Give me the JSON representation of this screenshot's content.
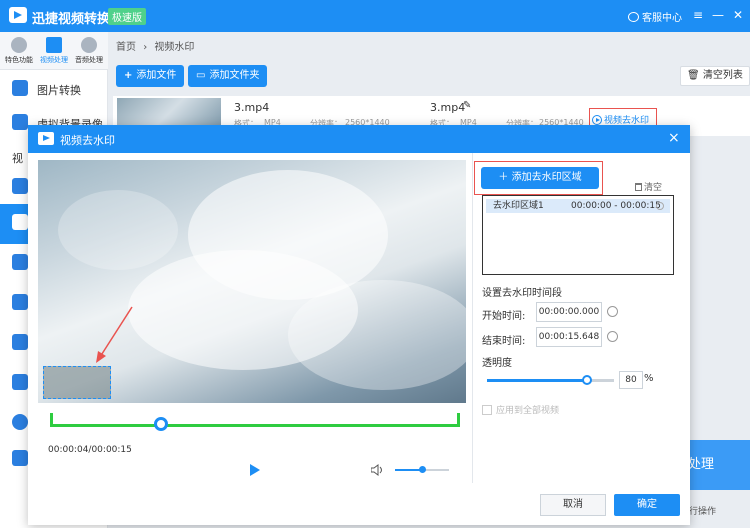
{
  "app": {
    "title": "迅捷视频转换器",
    "badge": "极速版",
    "support": "客服中心",
    "controls": [
      "≡",
      "—",
      "✕"
    ]
  },
  "nav_tabs": [
    {
      "label": "特色功能",
      "active": false
    },
    {
      "label": "视频处理",
      "active": true
    },
    {
      "label": "音频处理",
      "active": false
    }
  ],
  "sidebar": {
    "items": [
      "图片转换",
      "虚拟背景录像",
      "视"
    ]
  },
  "breadcrumb": {
    "home": "首页",
    "sep": "›",
    "current": "视频水印"
  },
  "toolbar": {
    "add_file": "添加文件",
    "add_folder": "添加文件夹",
    "clear_list": "清空列表"
  },
  "file_row": {
    "name_left": "3.mp4",
    "name_right": "3.mp4",
    "format_label": "格式：",
    "format": "MP4",
    "res_label": "分辨率：",
    "resolution": "2560*1440",
    "watermark_btn": "视频去水印"
  },
  "background": {
    "process": "处理",
    "status": "在行操作"
  },
  "modal": {
    "title": "视频去水印",
    "close": "×",
    "timecode": "00:00:04/00:00:15",
    "add_region": "添加去水印区域",
    "clear": "清空",
    "regions": [
      {
        "name": "去水印区域1",
        "start": "00:00:00",
        "end": "00:00:15"
      }
    ],
    "section_title": "设置去水印时间段",
    "start_label": "开始时间:",
    "start_value": "00:00:00.000",
    "end_label": "结束时间:",
    "end_value": "00:00:15.648",
    "opacity_label": "透明度",
    "opacity_value": "80",
    "opacity_unit": "%",
    "playback_progress": 0.27,
    "volume_level": 0.5,
    "apply_all": "应用到全部视频",
    "cancel": "取消",
    "ok": "确定"
  },
  "colors": {
    "primary": "#1d8ef4",
    "timeline": "#2ecc40",
    "highlight_box": "#e9534f"
  }
}
